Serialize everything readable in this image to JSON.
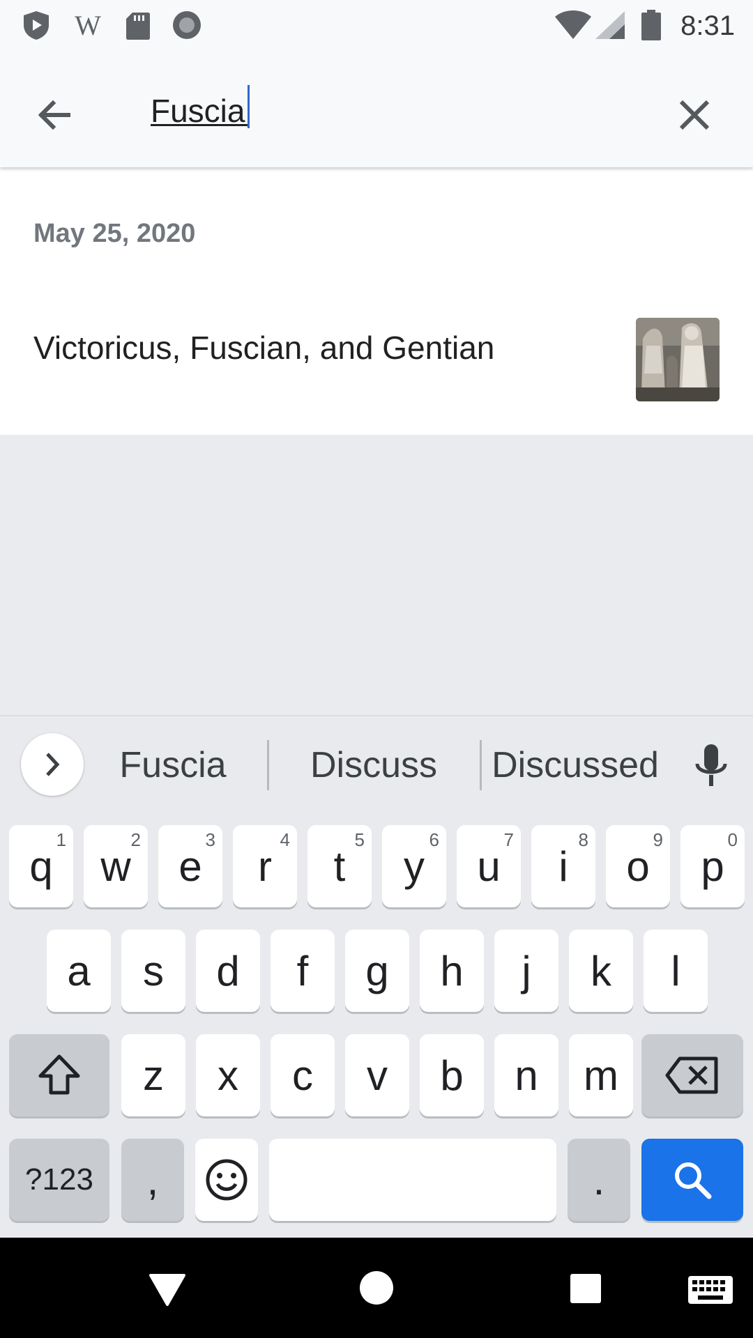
{
  "status_bar": {
    "time": "8:31",
    "left_icons": [
      "shield-play-icon",
      "wikipedia-icon",
      "sd-card-icon",
      "record-icon"
    ],
    "right_icons": [
      "wifi-icon",
      "signal-icon",
      "battery-icon"
    ]
  },
  "search": {
    "query": "Fuscia",
    "back_icon": "back-arrow-icon",
    "clear_icon": "close-icon"
  },
  "results": {
    "date_header": "May 25, 2020",
    "items": [
      {
        "title": "Victoricus, Fuscian, and Gentian",
        "thumbnail": "statue-thumbnail"
      }
    ]
  },
  "keyboard": {
    "suggestions": [
      "Fuscia",
      "Discuss",
      "Discussed"
    ],
    "row1": [
      {
        "letter": "q",
        "hint": "1"
      },
      {
        "letter": "w",
        "hint": "2"
      },
      {
        "letter": "e",
        "hint": "3"
      },
      {
        "letter": "r",
        "hint": "4"
      },
      {
        "letter": "t",
        "hint": "5"
      },
      {
        "letter": "y",
        "hint": "6"
      },
      {
        "letter": "u",
        "hint": "7"
      },
      {
        "letter": "i",
        "hint": "8"
      },
      {
        "letter": "o",
        "hint": "9"
      },
      {
        "letter": "p",
        "hint": "0"
      }
    ],
    "row2": [
      "a",
      "s",
      "d",
      "f",
      "g",
      "h",
      "j",
      "k",
      "l"
    ],
    "row3": [
      "z",
      "x",
      "c",
      "v",
      "b",
      "n",
      "m"
    ],
    "symbols_label": "?123",
    "comma_label": ",",
    "period_label": ".",
    "accent_color": "#1a73e8"
  },
  "navbar": {
    "icons": [
      "back-triangle-icon",
      "home-circle-icon",
      "recents-square-icon",
      "keyboard-icon"
    ]
  }
}
